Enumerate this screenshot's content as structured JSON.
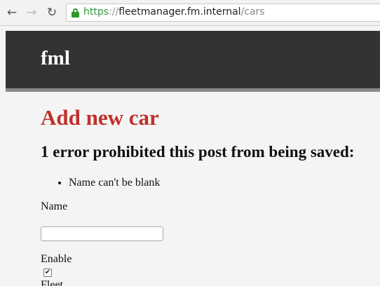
{
  "browser": {
    "url_scheme": "https",
    "url_separator": "://",
    "url_host": "fleetmanager.fm.internal",
    "url_path": "/cars",
    "back_icon": "←",
    "forward_icon": "→",
    "reload_icon": "↻"
  },
  "header": {
    "brand": "fml"
  },
  "main": {
    "title": "Add new car",
    "error_heading": "1 error prohibited this post from being saved:",
    "errors": [
      "Name can't be blank"
    ]
  },
  "form": {
    "name_label": "Name",
    "name_value": "",
    "enable_label": "Enable",
    "enable_checked": true,
    "fleet_label": "Fleet"
  },
  "colors": {
    "header_bg": "#333333",
    "title_red": "#c0302b",
    "page_bg": "#f4f4f4",
    "secure_green": "#2e9a2e"
  }
}
